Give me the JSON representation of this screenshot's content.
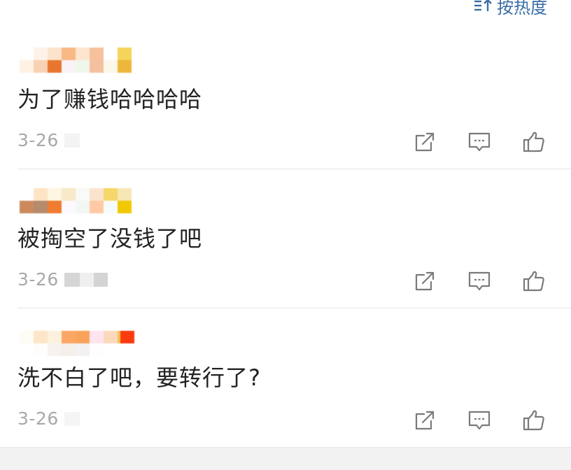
{
  "header": {
    "sort_label": "按热度",
    "sort_icon": "sort-icon"
  },
  "comments": [
    {
      "text": "为了赚钱哈哈哈哈",
      "date": "3-26",
      "name_colors": [
        [
          "#ffffff",
          "#fdf3e8",
          "#fbe2cc",
          "#f8b884",
          "#fde5cf",
          "#f6c19b",
          "#ffffff",
          "#f4d45a"
        ],
        [
          "#fff1e4",
          "#f8d2b4",
          "#e9762f",
          "#f9f2f7",
          "#eff7ea",
          "#f3c0a0",
          "#fbf7ea",
          "#ecb73c"
        ]
      ],
      "ip_colors": [
        "#f3f3f3",
        "#ffffff",
        "#ffffff"
      ]
    },
    {
      "text": "被掏空了没钱了吧",
      "date": "3-26",
      "name_colors": [
        [
          "#ffffff",
          "#fde4c4",
          "#fff5e3",
          "#f8e9c8",
          "#f7faf6",
          "#fbe3cd",
          "#f5d76c",
          "#f6e7b4"
        ],
        [
          "#cc8a5c",
          "#b58b6e",
          "#ef7c31",
          "#fdf8fd",
          "#f3f7f4",
          "#fec9a4",
          "#f6fcfb",
          "#f2c800"
        ]
      ],
      "ip_colors": [
        "#d6d6d6",
        "#efefef",
        "#d4d4d4"
      ]
    },
    {
      "text": "洗不白了吧，要转行了?",
      "date": "3-26",
      "name_colors": [
        [
          "#fffbf5",
          "#fce6c7",
          "#fdf1de",
          "#fba764",
          "#f9a35a",
          "#fde4ee",
          "#fbd9bc",
          "#f1c44f"
        ],
        [
          "#ffffff",
          "#fefdfb",
          "#f7f2ef",
          "#f4efe9",
          "#f3f1f1",
          "#fefefe",
          "#ffffff",
          "#ffffff"
        ]
      ],
      "extra_color": "#fb3a0d",
      "ip_colors": [
        "#f5f5f5",
        "#ffffff",
        "#ffffff"
      ]
    }
  ],
  "actions": {
    "icons": [
      "share-icon",
      "comment-icon",
      "like-icon"
    ],
    "icon_color": "#7a7a7a"
  },
  "colors": {
    "accent": "#3a6ea5",
    "text": "#222222",
    "meta": "#a8a8a8",
    "divider": "#e6e6e6",
    "footer_bg": "#f2f2f2"
  }
}
